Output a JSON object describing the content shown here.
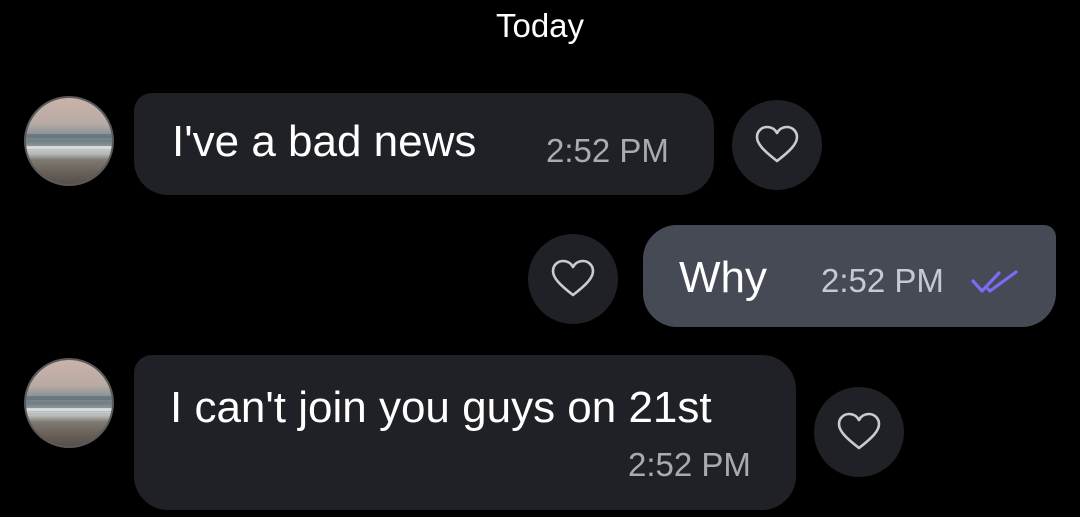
{
  "date_divider": "Today",
  "messages": [
    {
      "sender": "contact",
      "text": "I've a bad news",
      "time": "2:52 PM"
    },
    {
      "sender": "me",
      "text": "Why",
      "time": "2:52 PM",
      "status_icon": "double-check-icon",
      "status_color": "#7b6cf6"
    },
    {
      "sender": "contact",
      "text": "I can't join you guys on 21st",
      "time": "2:52 PM"
    }
  ],
  "colors": {
    "background": "#000000",
    "incoming_bubble": "#1f2127",
    "outgoing_bubble": "#464a55",
    "read_receipt": "#7b6cf6"
  },
  "icons": {
    "react": "heart-outline-icon",
    "avatar": "beach-photo-avatar"
  }
}
